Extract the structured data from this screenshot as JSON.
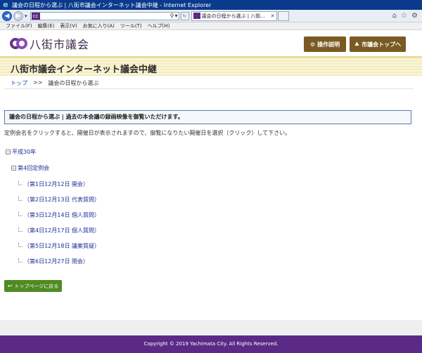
{
  "window": {
    "title": "議会の日程から選ぶ | 八街市議会インターネット議会中継 - Internet Explorer"
  },
  "browser": {
    "tab_title": "議会の日程から選ぶ | 八街...",
    "favicon_text": "cc",
    "back_icon": "back-arrow-icon",
    "forward_icon": "forward-arrow-icon",
    "search_icon": "search-icon",
    "refresh_icon": "refresh-icon",
    "home_icon": "home-icon",
    "favorites_icon": "star-icon",
    "tools_icon": "gear-icon",
    "menu": [
      "ファイル(F)",
      "編集(E)",
      "表示(V)",
      "お気に入り(A)",
      "ツール(T)",
      "ヘルプ(H)"
    ]
  },
  "site": {
    "logo_text": "八街市議会",
    "buttons": {
      "manual": "操作説明",
      "council_top": "市議会トップへ"
    },
    "banner_title": "八街市議会インターネット議会中継",
    "breadcrumb": {
      "top": "トップ",
      "separator": ">>",
      "current": "議会の日程から選ぶ"
    },
    "notice": "議会の日程から選ぶ | 過去の本会議の録画映像を御覧いただけます。",
    "instruction": "定例会名をクリックすると、開催日が表示されますので、御覧になりたい開催日を選択（クリック）して下さい。",
    "tree": {
      "year": "平成30年",
      "year_toggle": "−",
      "session": "第4回定例会",
      "session_toggle": "−",
      "days": [
        "（第1日12月12日 開会）",
        "（第2日12月13日 代表質問）",
        "（第3日12月14日 個人質問）",
        "（第4日12月17日 個人質問）",
        "（第5日12月18日 議案質疑）",
        "（第6日12月27日 閉会）"
      ]
    },
    "back_button": "トップページに戻る",
    "footer": "Copyright © 2019 Yachimata City. All Rights Reserved.",
    "colors": {
      "purple": "#5b2a86",
      "brown_button": "#7a5a22",
      "green_button": "#4f8b22",
      "link": "#1a2f96"
    }
  }
}
